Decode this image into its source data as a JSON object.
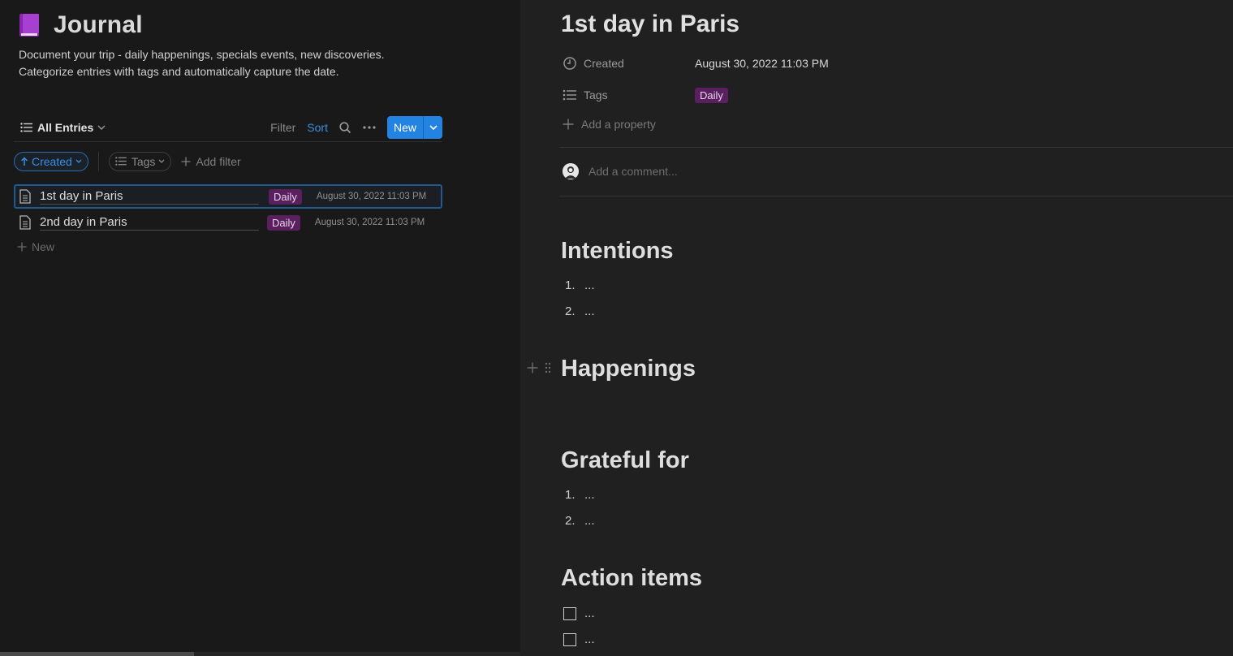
{
  "database": {
    "icon": "purple-book-icon",
    "title": "Journal",
    "description_line1": "Document your trip - daily happenings, specials events, new discoveries.",
    "description_line2": "Categorize entries with tags and automatically capture the date."
  },
  "view": {
    "name": "All Entries",
    "filter_label": "Filter",
    "sort_label": "Sort",
    "new_label": "New"
  },
  "filters": {
    "sort_chip": "Created",
    "tags_chip": "Tags",
    "add_filter": "Add filter"
  },
  "entries": [
    {
      "name": "1st day in Paris",
      "tag": "Daily",
      "date": "August 30, 2022 11:03 PM"
    },
    {
      "name": "2nd day in Paris",
      "tag": "Daily",
      "date": "August 30, 2022 11:03 PM"
    }
  ],
  "add_new_label": "New",
  "page": {
    "title": "1st day in Paris",
    "properties": {
      "created_label": "Created",
      "created_value": "August 30, 2022 11:03 PM",
      "tags_label": "Tags",
      "tags_value": "Daily",
      "add_property": "Add a property"
    },
    "comment_placeholder": "Add a comment...",
    "sections": {
      "intentions": {
        "heading": "Intentions",
        "items": [
          "...",
          "..."
        ]
      },
      "happenings": {
        "heading": "Happenings"
      },
      "grateful": {
        "heading": "Grateful for",
        "items": [
          "...",
          "..."
        ]
      },
      "actions": {
        "heading": "Action items",
        "items": [
          "...",
          "..."
        ]
      }
    }
  },
  "colors": {
    "accent": "#2383e2",
    "tag_bg": "#5a1f5e",
    "book_icon": "#9b2fc0"
  }
}
